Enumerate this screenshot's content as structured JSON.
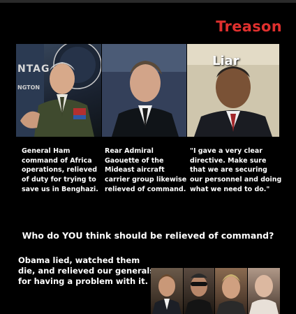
{
  "title": "Treason",
  "photos": {
    "first": {
      "watermark": "NTAG",
      "watermark_sub": "NGTON"
    },
    "third": {
      "overlay_label": "Liar"
    }
  },
  "captions": [
    "General Ham command of Africa operations, relieved of duty for trying to save us in Benghazi.",
    "Rear Admiral Gaouette of the Mideast aircraft carrier group likewise relieved of command.",
    "\"I gave a very clear directive. Make sure that we are securing our personnel and doing what we need to do.\""
  ],
  "question": "Who do YOU think should be relieved of command?",
  "bottom_text": "Obama lied, watched them die, and relieved our generals for having a problem with it.",
  "colors": {
    "title_red": "#e0302e",
    "background": "#000000",
    "text": "#ffffff"
  }
}
